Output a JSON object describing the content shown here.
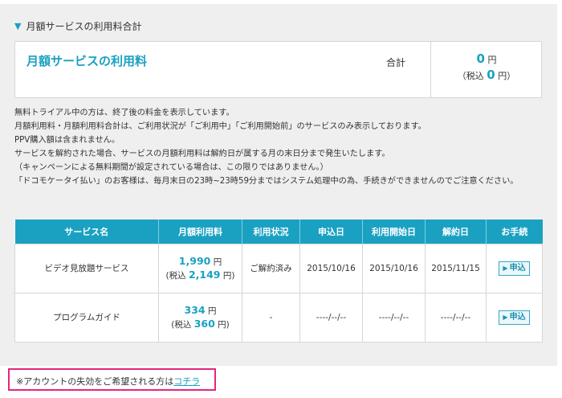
{
  "section": {
    "title": "月額サービスの利用料合計",
    "marker": "▼"
  },
  "summary": {
    "service_title": "月額サービスの利用料",
    "total_label": "合計",
    "amount": "0",
    "amount_unit": "円",
    "tax_prefix": "（税込",
    "tax_amount": "0",
    "tax_suffix": "円）"
  },
  "notes": [
    "無料トライアル中の方は、終了後の料金を表示しています。",
    "月額利用料・月額利用料合計は、ご利用状況が「ご利用中」「ご利用開始前」のサービスのみ表示しております。",
    "PPV購入額は含まれません。",
    "サービスを解約された場合、サービスの月額利用料は解約日が属する月の末日分まで発生いたします。",
    "（キャンペーンによる無料期間が設定されている場合は、この限りではありません。）",
    "「ドコモケータイ払い」のお客様は、毎月末日の23時~23時59分まではシステム処理中の為、手続きができませんのでご注意ください。"
  ],
  "table": {
    "headers": [
      "サービス名",
      "月額利用料",
      "利用状況",
      "申込日",
      "利用開始日",
      "解約日",
      "お手続"
    ],
    "rows": [
      {
        "name": "ビデオ見放題サービス",
        "price": "1,990",
        "price_unit": "円",
        "tax_prefix": "(税込",
        "tax_price": "2,149",
        "tax_suffix": "円)",
        "status": "ご解約済み",
        "applied": "2015/10/16",
        "started": "2015/10/16",
        "cancelled": "2015/11/15",
        "action": "申込"
      },
      {
        "name": "プログラムガイド",
        "price": "334",
        "price_unit": "円",
        "tax_prefix": "(税込",
        "tax_price": "360",
        "tax_suffix": "円)",
        "status": "-",
        "applied": "----/--/--",
        "started": "----/--/--",
        "cancelled": "----/--/--",
        "action": "申込"
      }
    ]
  },
  "footer": {
    "text": "※アカウントの失効をご希望される方は",
    "link": "コチラ"
  },
  "colors": {
    "accent": "#1aa1c2",
    "highlight_border": "#e5267c",
    "panel_bg": "#efefef"
  }
}
